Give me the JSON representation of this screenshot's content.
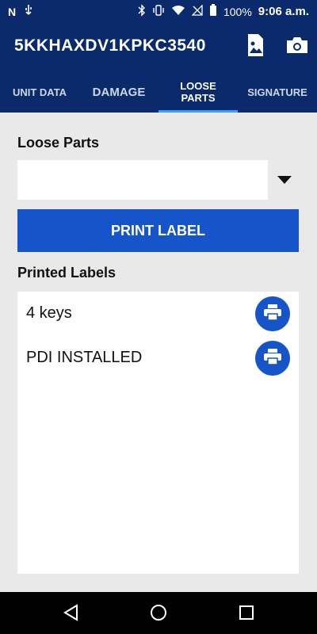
{
  "status_bar": {
    "battery": "100%",
    "time": "9:06 a.m."
  },
  "app_bar": {
    "title": "5KKHAXDV1KPKC3540",
    "icons": [
      "image-icon",
      "camera-icon"
    ]
  },
  "tabs": [
    {
      "label": "UNIT DATA"
    },
    {
      "label": "DAMAGE"
    },
    {
      "label": "LOOSE\nPARTS",
      "active": true
    },
    {
      "label": "SIGNATURE"
    }
  ],
  "loose_parts": {
    "label": "Loose Parts",
    "selected_value": ""
  },
  "print_button": {
    "label": "PRINT LABEL"
  },
  "printed_labels": {
    "label": "Printed Labels",
    "items": [
      "4 keys",
      "PDI INSTALLED"
    ]
  },
  "colors": {
    "primary": "#0a2a6b",
    "accent": "#1554c9",
    "tab_indicator": "#3aa0ff"
  }
}
